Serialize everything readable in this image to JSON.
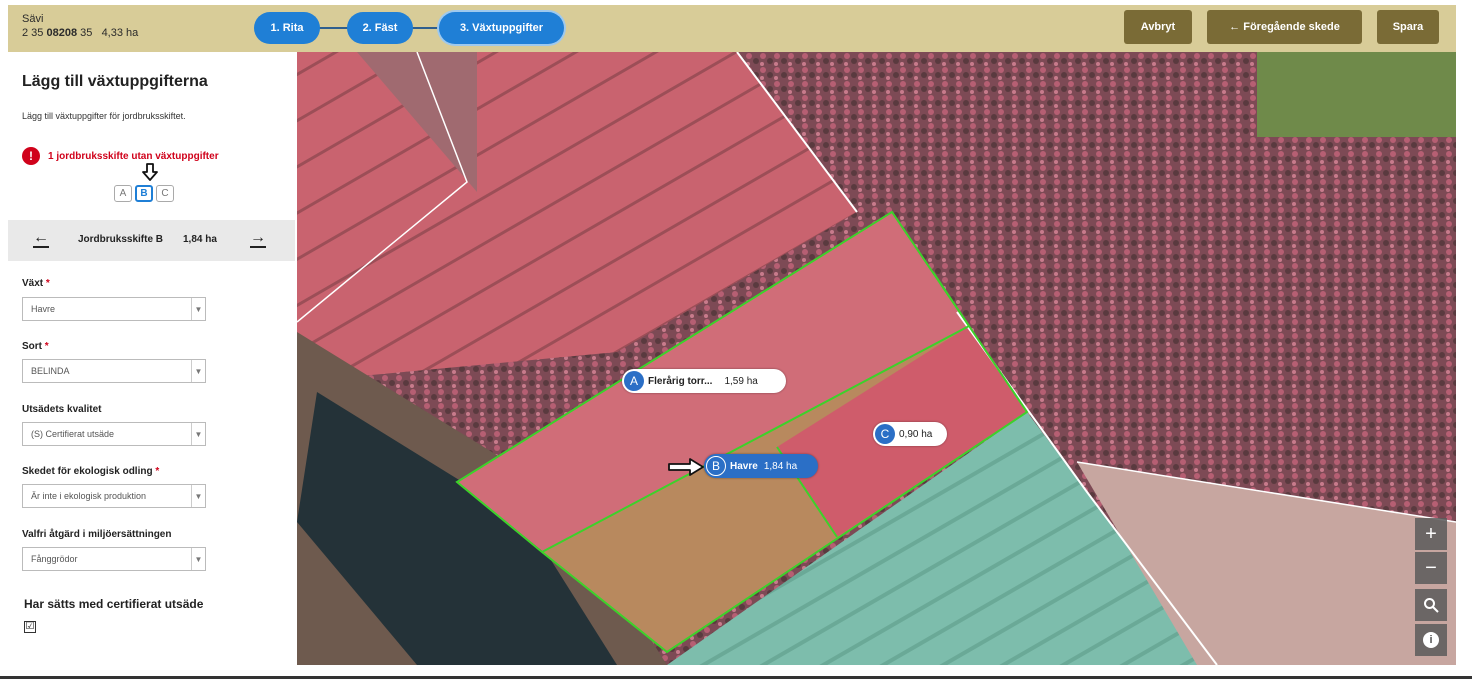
{
  "property": {
    "name": "Sävi",
    "id_prefix": "2 35",
    "id_bold": "08208",
    "id_suffix": "35",
    "area": "4,33 ha"
  },
  "steps": [
    "1. Rita",
    "2. Fäst",
    "3. Växtuppgifter"
  ],
  "toolbar": {
    "cancel_label": "Avbryt",
    "prev_label": "← Föregående skede",
    "save_label": "Spara"
  },
  "sidebar": {
    "title": "Lägg till växtuppgifterna",
    "description": "Lägg till växtuppgifter för jordbruksskiftet.",
    "warning_icon": "!",
    "warning_text": "1 jordbruksskifte utan växtuppgifter",
    "parcel_chips": [
      "A",
      "B",
      "C"
    ],
    "parcel_nav": {
      "prev": "←",
      "next": "→",
      "label": "Jordbruksskifte B",
      "size": "1,84 ha"
    },
    "fields": [
      {
        "label": "Växt",
        "required": "*",
        "value": "Havre"
      },
      {
        "label": "Sort",
        "required": "*",
        "value": "BELINDA"
      },
      {
        "label": "Utsädets kvalitet",
        "required": "",
        "value": "(S) Certifierat utsäde"
      },
      {
        "label": "Skedet för ekologisk odling",
        "required": "*",
        "value": "Är inte i ekologisk produktion"
      },
      {
        "label": "Valfri åtgärd i miljöersättningen",
        "required": "",
        "value": "Fånggrödor"
      }
    ],
    "certified_label": "Har sätts med certifierat utsäde",
    "certified_check": "☑"
  },
  "map": {
    "parcels": [
      {
        "letter": "A",
        "name": "Flerårig torr...",
        "area": "1,59 ha"
      },
      {
        "letter": "B",
        "name": "Havre",
        "area": "1,84 ha"
      },
      {
        "letter": "C",
        "name": "",
        "area": "0,90 ha"
      }
    ],
    "controls": {
      "zoom_in": "+",
      "zoom_out": "−",
      "search": "search-icon",
      "info": "i"
    }
  },
  "colors": {
    "accent": "#1f7fd6",
    "topbar": "#d8cc98",
    "toolbar_button": "#7a6b36",
    "warning": "#d0021b",
    "parcel_outline": "#3cd22a"
  }
}
